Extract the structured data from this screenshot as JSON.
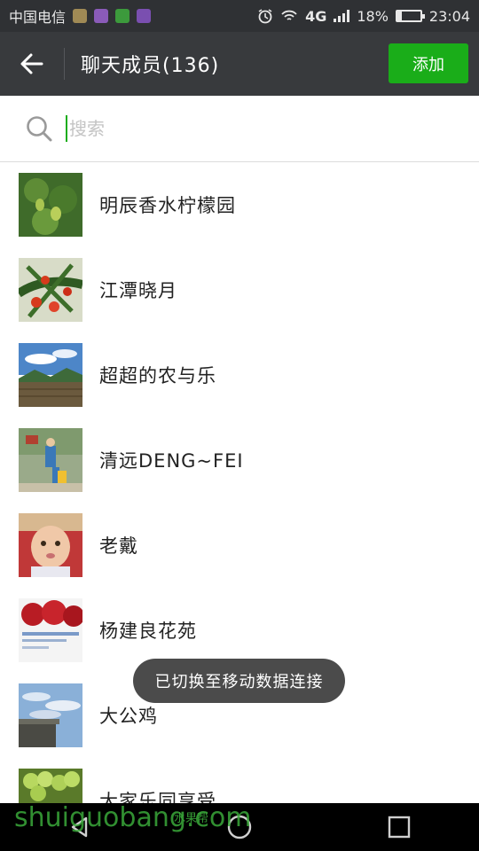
{
  "status_bar": {
    "carrier": "中国电信",
    "network": "4G",
    "battery_percent": "18%",
    "battery_level": 0.18,
    "time": "23:04"
  },
  "header": {
    "title": "聊天成员(136)",
    "add_label": "添加",
    "accent_color": "#1aad19"
  },
  "search": {
    "placeholder": "搜索"
  },
  "members": [
    {
      "name": "明辰香水柠檬园",
      "avatar": "lemon-tree"
    },
    {
      "name": "江潭晓月",
      "avatar": "red-fruit-branch"
    },
    {
      "name": "超超的农与乐",
      "avatar": "mountain-landscape"
    },
    {
      "name": "清远DENG~FEI",
      "avatar": "family-outdoor"
    },
    {
      "name": "老戴",
      "avatar": "baby-portrait"
    },
    {
      "name": "杨建良花苑",
      "avatar": "apples"
    },
    {
      "name": "大公鸡",
      "avatar": "sky-building"
    },
    {
      "name": "大家乐同享受",
      "avatar": "green-grapes"
    }
  ],
  "toast": {
    "message": "已切换至移动数据连接"
  },
  "watermark": {
    "text": "shuiguobang.com",
    "sub": "水果帮"
  }
}
